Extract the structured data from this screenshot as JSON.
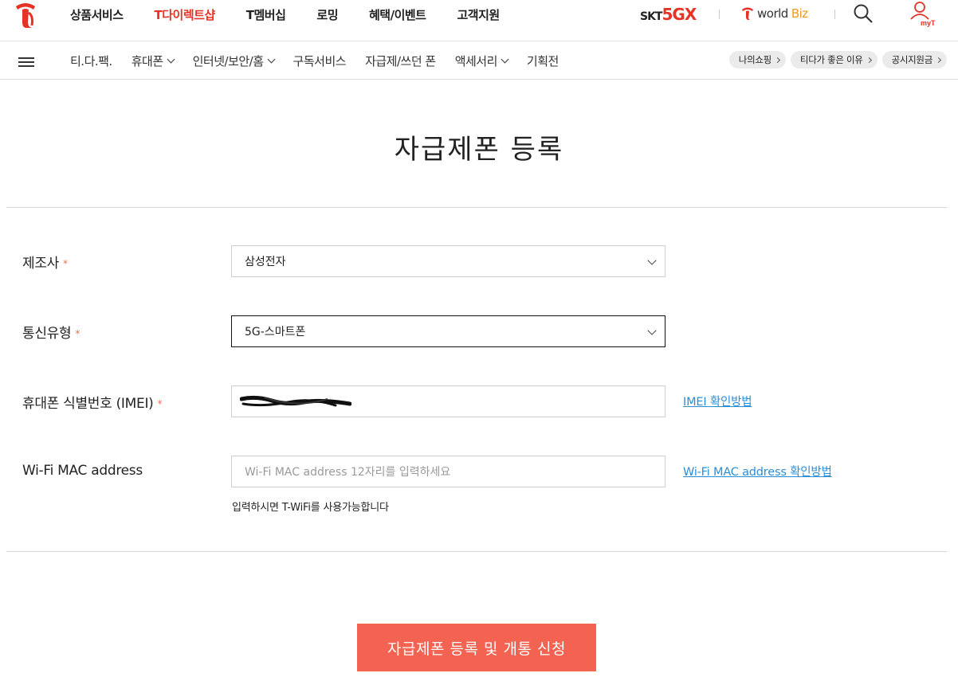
{
  "header": {
    "nav": [
      "상품서비스",
      "T다이렉트샵",
      "T멤버십",
      "로밍",
      "혜택/이벤트",
      "고객지원"
    ],
    "active_nav": "T다이렉트샵",
    "brand_5gx": {
      "skt": "SKT",
      "g": "5GX"
    },
    "worldbiz": {
      "world": "world",
      "biz": "Biz"
    },
    "myt": "myT"
  },
  "subnav": {
    "items": [
      {
        "label": "티.다.팩.",
        "has_dropdown": false
      },
      {
        "label": "휴대폰",
        "has_dropdown": true
      },
      {
        "label": "인터넷/보안/홈",
        "has_dropdown": true
      },
      {
        "label": "구독서비스",
        "has_dropdown": false
      },
      {
        "label": "자급제/쓰던 폰",
        "has_dropdown": false
      },
      {
        "label": "액세서리",
        "has_dropdown": true
      },
      {
        "label": "기획전",
        "has_dropdown": false
      }
    ],
    "pills": [
      "나의쇼핑",
      "티다가 좋은 이유",
      "공시지원금"
    ]
  },
  "page": {
    "title": "자급제폰 등록"
  },
  "form": {
    "manufacturer": {
      "label": "제조사",
      "required_mark": "*",
      "value": "삼성전자"
    },
    "network": {
      "label": "통신유형",
      "required_mark": "*",
      "value": "5G-스마트폰"
    },
    "imei": {
      "label": "휴대폰 식별번호 (IMEI)",
      "required_mark": "*",
      "value": "",
      "help_link": "IMEI 확인방법"
    },
    "wifi_mac": {
      "label": "Wi-Fi MAC address",
      "placeholder": "Wi-Fi MAC address 12자리를 입력하세요",
      "help_link": "Wi-Fi MAC address 확인방법",
      "hint": "입력하시면 T-WiFi를 사용가능합니다"
    }
  },
  "submit_label": "자급제폰 등록 및 개통 신청",
  "colors": {
    "brand_red": "#e53326",
    "submit_bg": "#f46251",
    "link_blue": "#2a8fd8",
    "required": "#f06a5a"
  }
}
